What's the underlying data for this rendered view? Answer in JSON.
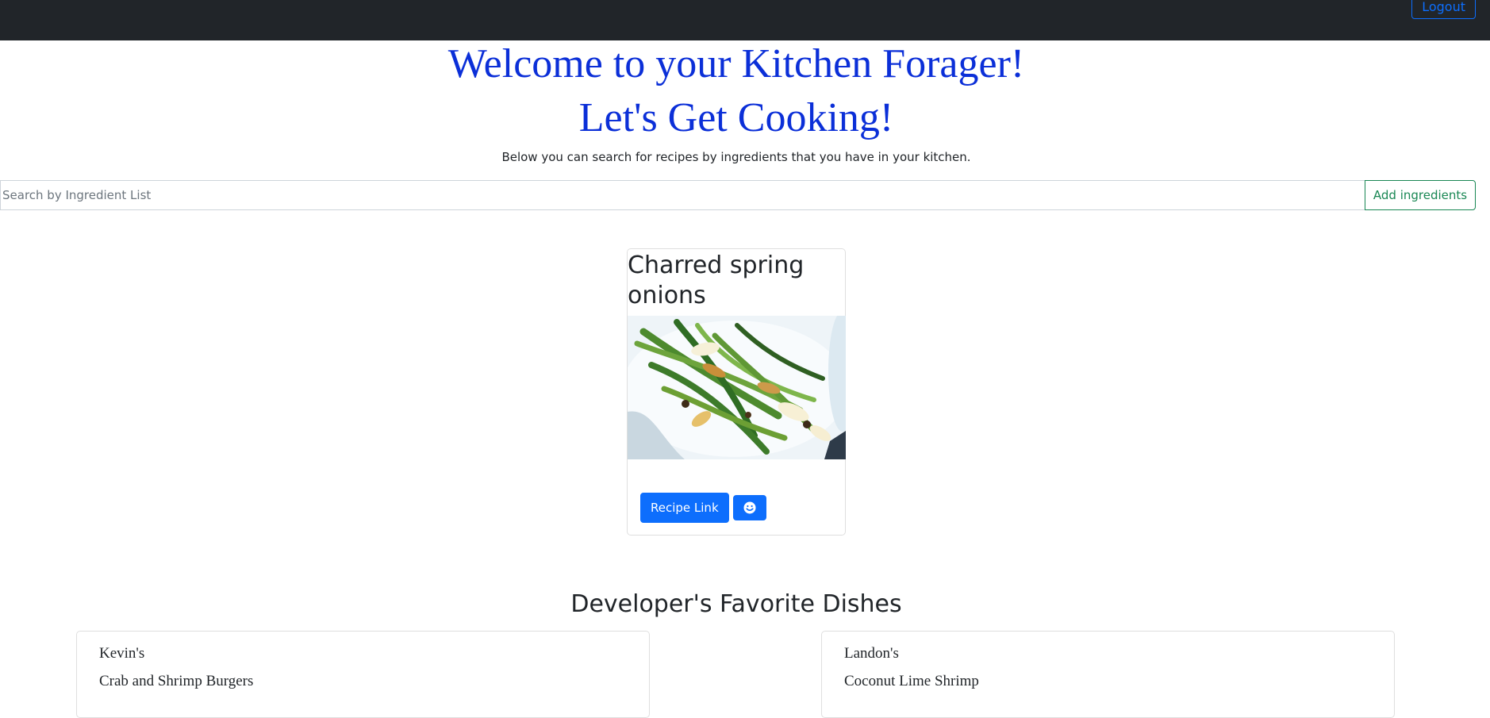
{
  "navbar": {
    "logout_label": "Logout"
  },
  "hero": {
    "title_line1": "Welcome to your Kitchen Forager!",
    "title_line2": "Let's Get Cooking!",
    "subtitle": "Below you can search for recipes by ingredients that you have in your kitchen."
  },
  "search": {
    "placeholder": "Search by Ingredient List",
    "value": "",
    "add_label": "Add ingredients"
  },
  "recipe": {
    "title": "Charred spring onions",
    "link_label": "Recipe Link",
    "favorite_icon": "smiley-icon"
  },
  "favorites": {
    "title": "Developer's Favorite Dishes",
    "cards": [
      {
        "name": "Kevin's",
        "dish": "Crab and Shrimp Burgers"
      },
      {
        "name": "Landon's",
        "dish": "Coconut Lime Shrimp"
      }
    ]
  },
  "colors": {
    "navbar": "#212529",
    "hero_text": "#0b2fd8",
    "primary": "#0d6efd",
    "success": "#198754"
  }
}
